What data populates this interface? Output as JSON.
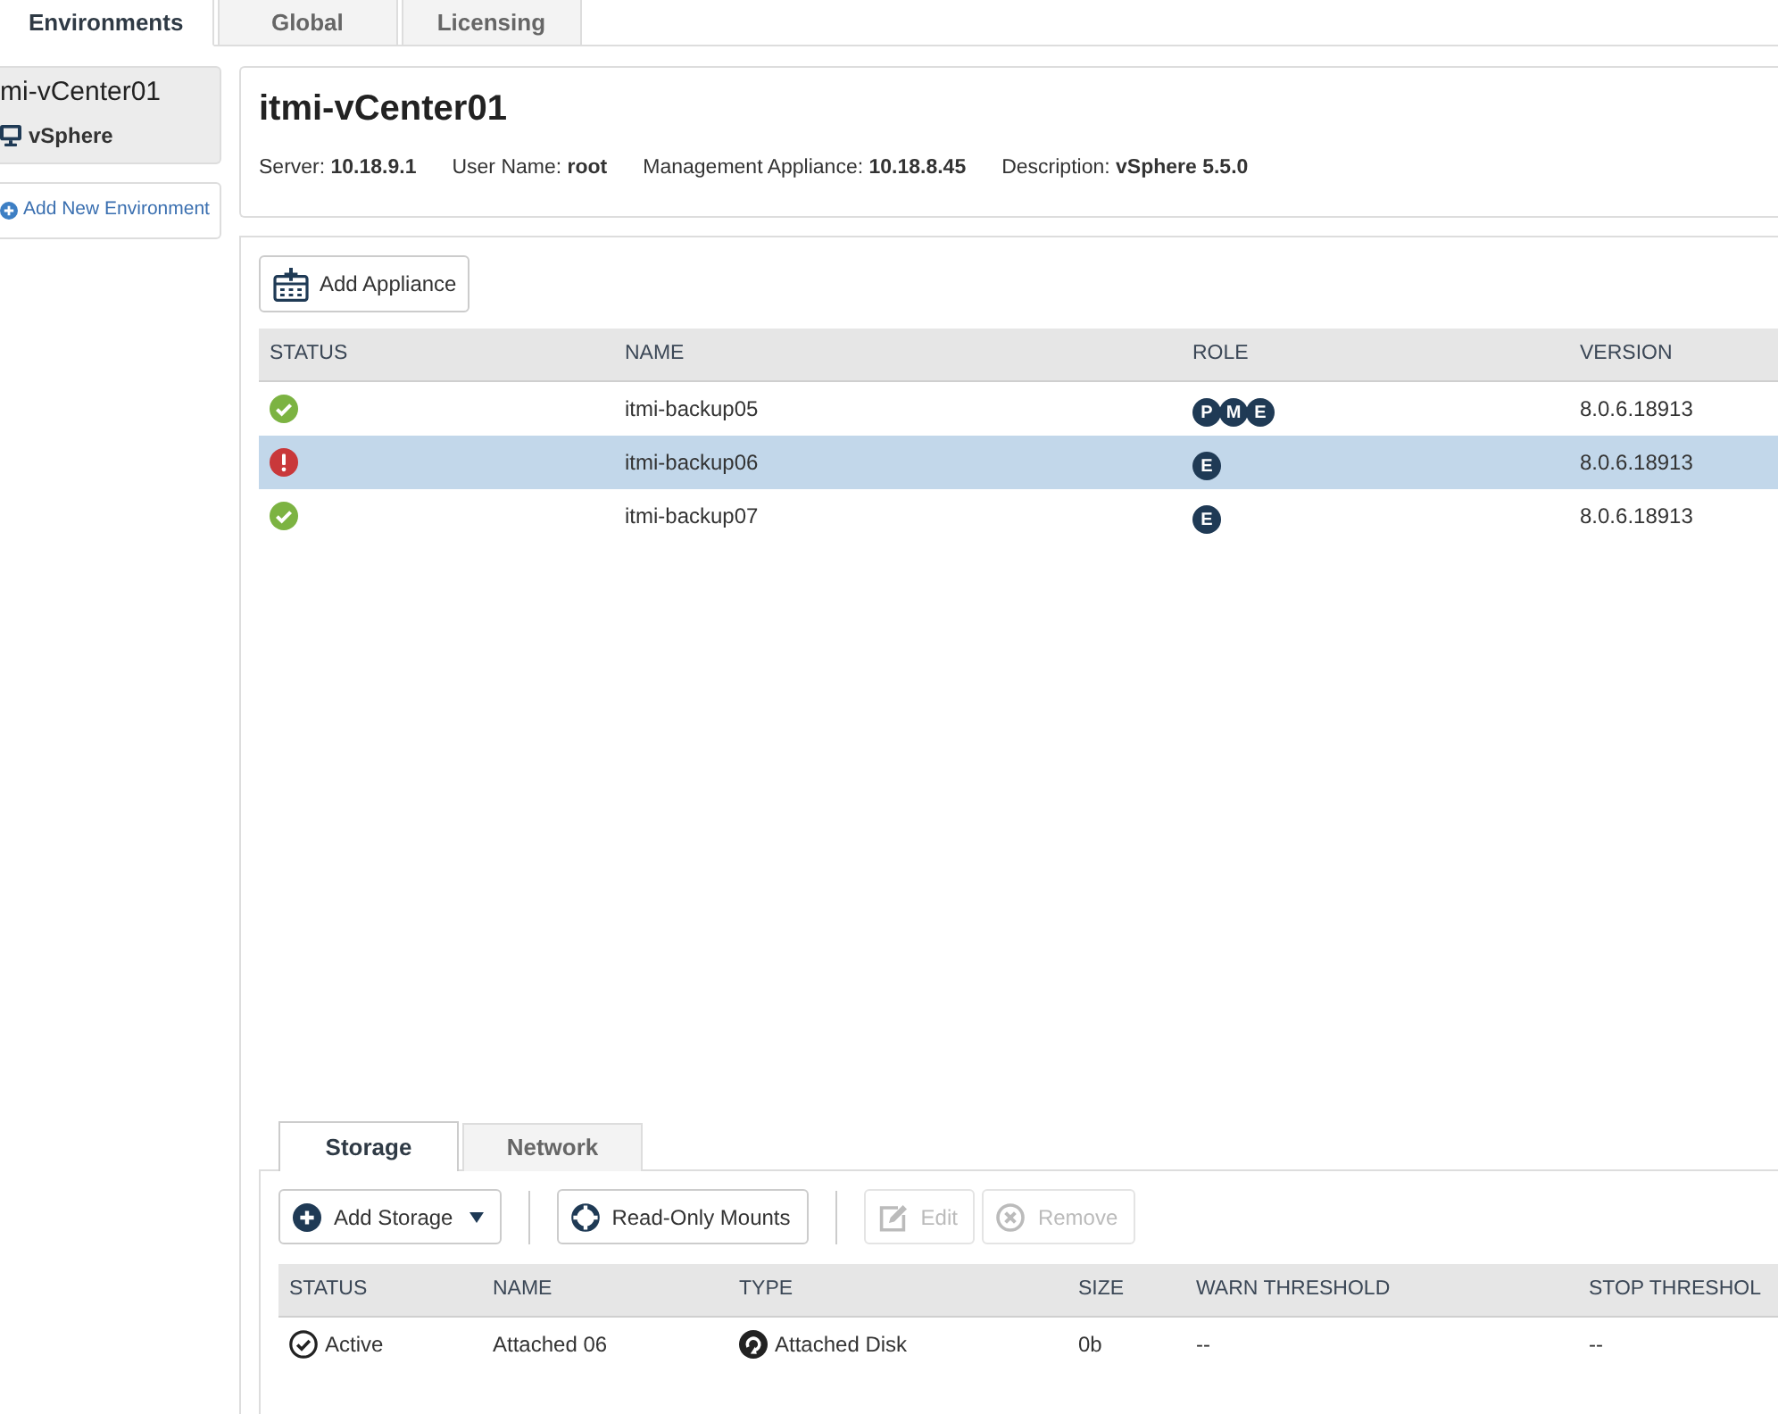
{
  "top_tabs": [
    {
      "label": "Environments",
      "selected": true
    },
    {
      "label": "Global",
      "selected": false
    },
    {
      "label": "Licensing",
      "selected": false
    }
  ],
  "sidebar": {
    "environments": [
      {
        "name": "mi-vCenter01",
        "type": "vSphere",
        "selected": true
      }
    ],
    "add_link": "Add New Environment"
  },
  "environment": {
    "title": "itmi-vCenter01",
    "details": [
      "Server: **10.18.9.1**",
      "User Name: **root**",
      "Management Appliance: **10.18.8.45**",
      "Description: **vSphere 5.5.0**"
    ]
  },
  "appliances": {
    "add_button": "Add Appliance",
    "columns": [
      "STATUS",
      "NAME",
      "ROLE",
      "VERSION"
    ],
    "rows": [
      {
        "kind": "ok",
        "name": "itmi-backup05",
        "roles": [
          "P",
          "M",
          "E"
        ],
        "version": "8.0.6.18913",
        "selected": false
      },
      {
        "kind": "error",
        "name": "itmi-backup06",
        "roles": [
          "E"
        ],
        "version": "8.0.6.18913",
        "selected": true
      },
      {
        "kind": "ok",
        "name": "itmi-backup07",
        "roles": [
          "E"
        ],
        "version": "8.0.6.18913",
        "selected": false
      }
    ]
  },
  "storage": {
    "tabs": [
      {
        "label": "Storage",
        "selected": true
      },
      {
        "label": "Network",
        "selected": false
      }
    ],
    "toolbar_groups": [
      [
        {
          "label": "Add Storage",
          "kind": "add",
          "dropdown": true,
          "disabled": false
        }
      ],
      [
        {
          "label": "Read-Only Mounts",
          "kind": "mounts",
          "dropdown": false,
          "disabled": false
        }
      ],
      [
        {
          "label": "Edit",
          "kind": "edit",
          "dropdown": false,
          "disabled": true
        },
        {
          "label": "Remove",
          "kind": "remove",
          "dropdown": false,
          "disabled": true
        }
      ]
    ],
    "columns": [
      "STATUS",
      "NAME",
      "TYPE",
      "SIZE",
      "WARN THRESHOLD",
      "STOP THRESHOL"
    ],
    "rows": [
      {
        "status": {
          "kind": "active",
          "label": "Active"
        },
        "name": "Attached 06",
        "type": {
          "kind": "disk",
          "label": "Attached Disk"
        },
        "size": "0b",
        "warn_threshold": "--",
        "stop_threshold": "--"
      }
    ]
  }
}
